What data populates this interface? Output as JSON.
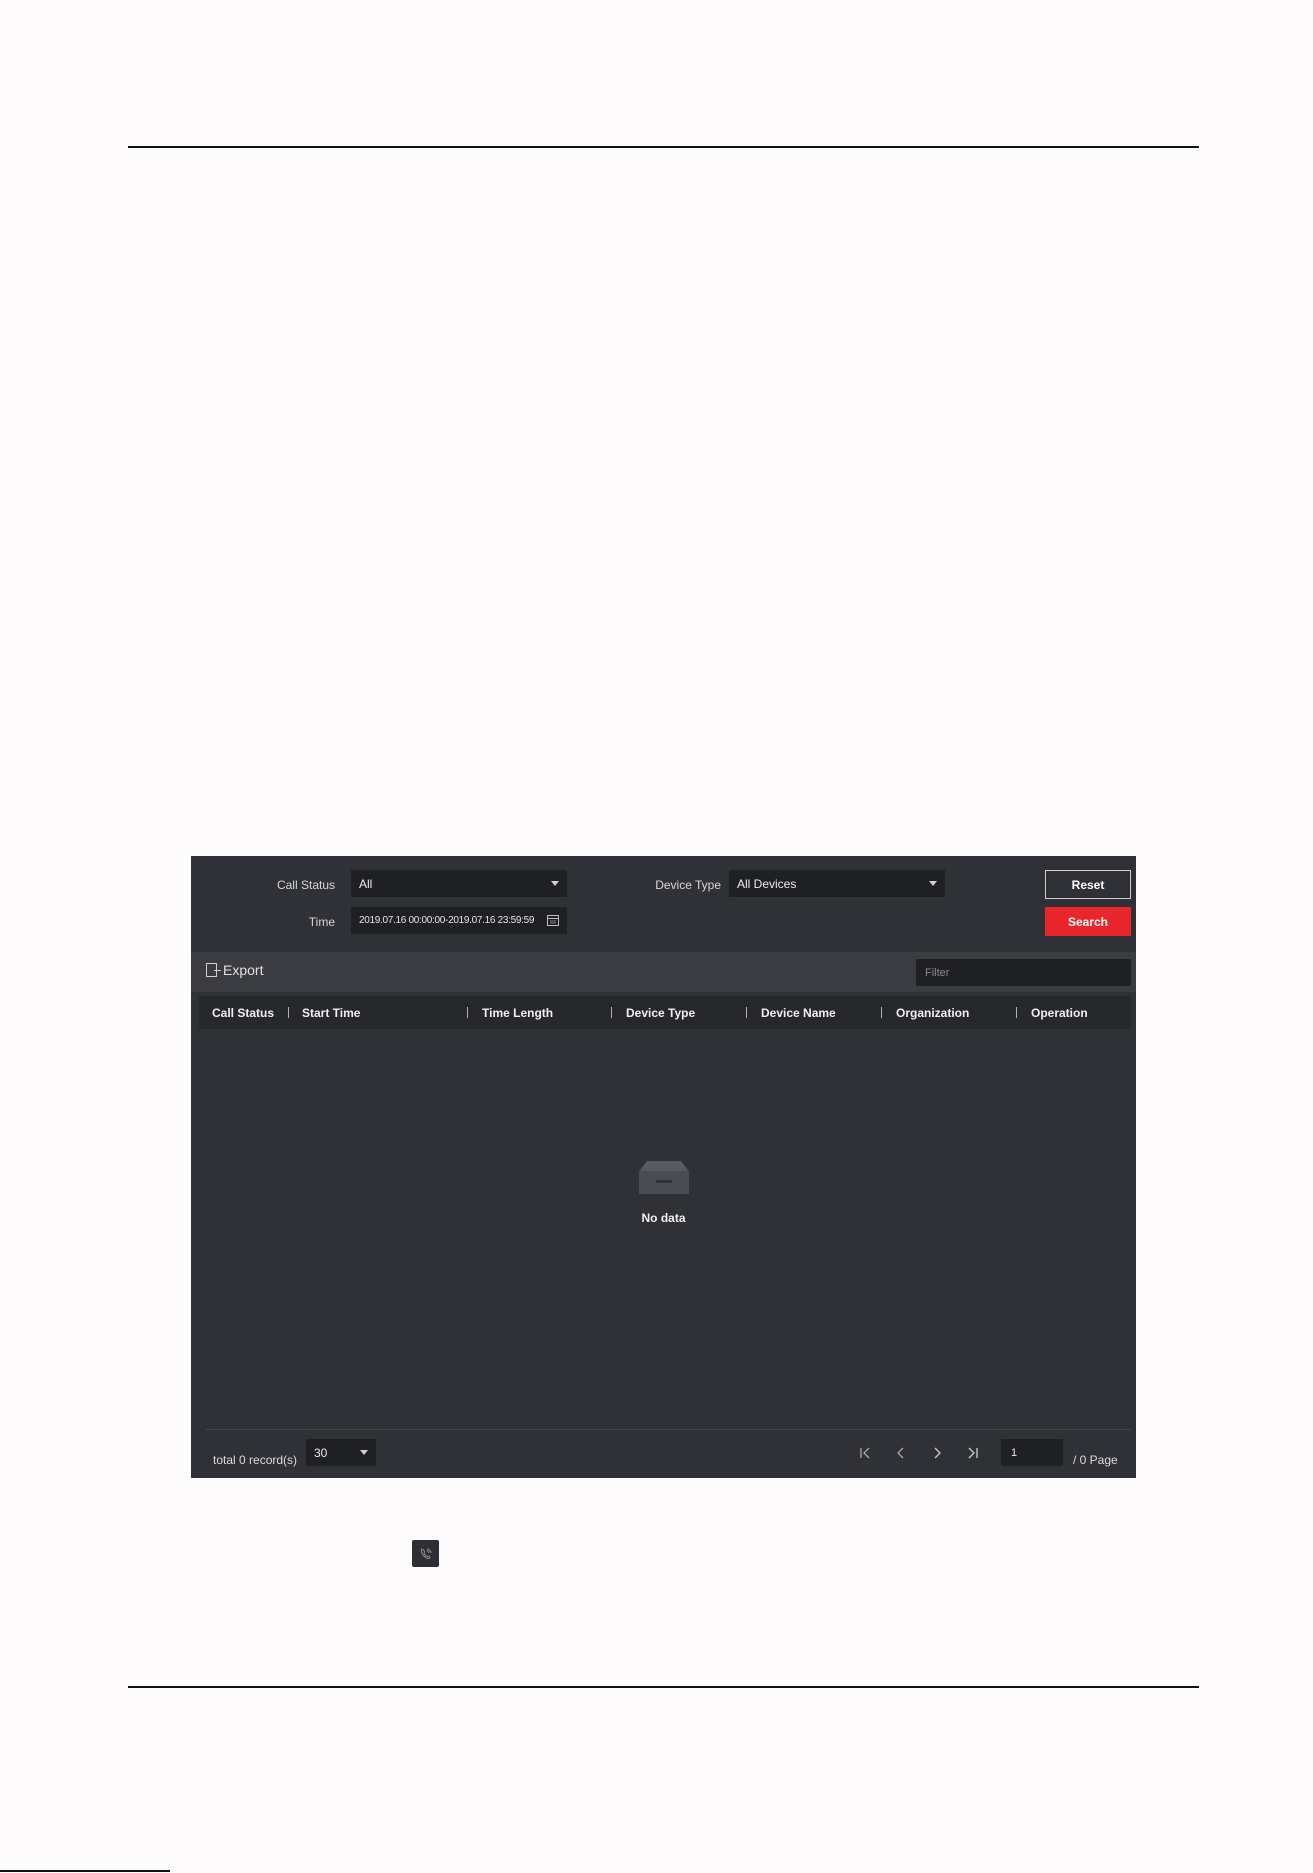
{
  "filters": {
    "call_status_label": "Call Status",
    "call_status_value": "All",
    "device_type_label": "Device Type",
    "device_type_value": "All Devices",
    "time_label": "Time",
    "time_value": "2019.07.16 00:00:00-2019.07.16 23:59:59",
    "reset_label": "Reset",
    "search_label": "Search"
  },
  "toolbar": {
    "export_label": "Export",
    "filter_placeholder": "Filter"
  },
  "table": {
    "columns": [
      "Call Status",
      "Start Time",
      "Time Length",
      "Device Type",
      "Device Name",
      "Organization",
      "Operation"
    ],
    "empty_text": "No data"
  },
  "footer": {
    "total_records": "total 0 record(s)",
    "page_size": "30",
    "current_page": "1",
    "page_total": "/ 0 Page"
  },
  "colors": {
    "panel_bg": "#2f3136",
    "search_button": "#e9262b"
  },
  "icons": [
    "calendar-icon",
    "export-icon",
    "empty-tray-icon",
    "first-page-icon",
    "prev-page-icon",
    "next-page-icon",
    "last-page-icon",
    "call-icon"
  ]
}
